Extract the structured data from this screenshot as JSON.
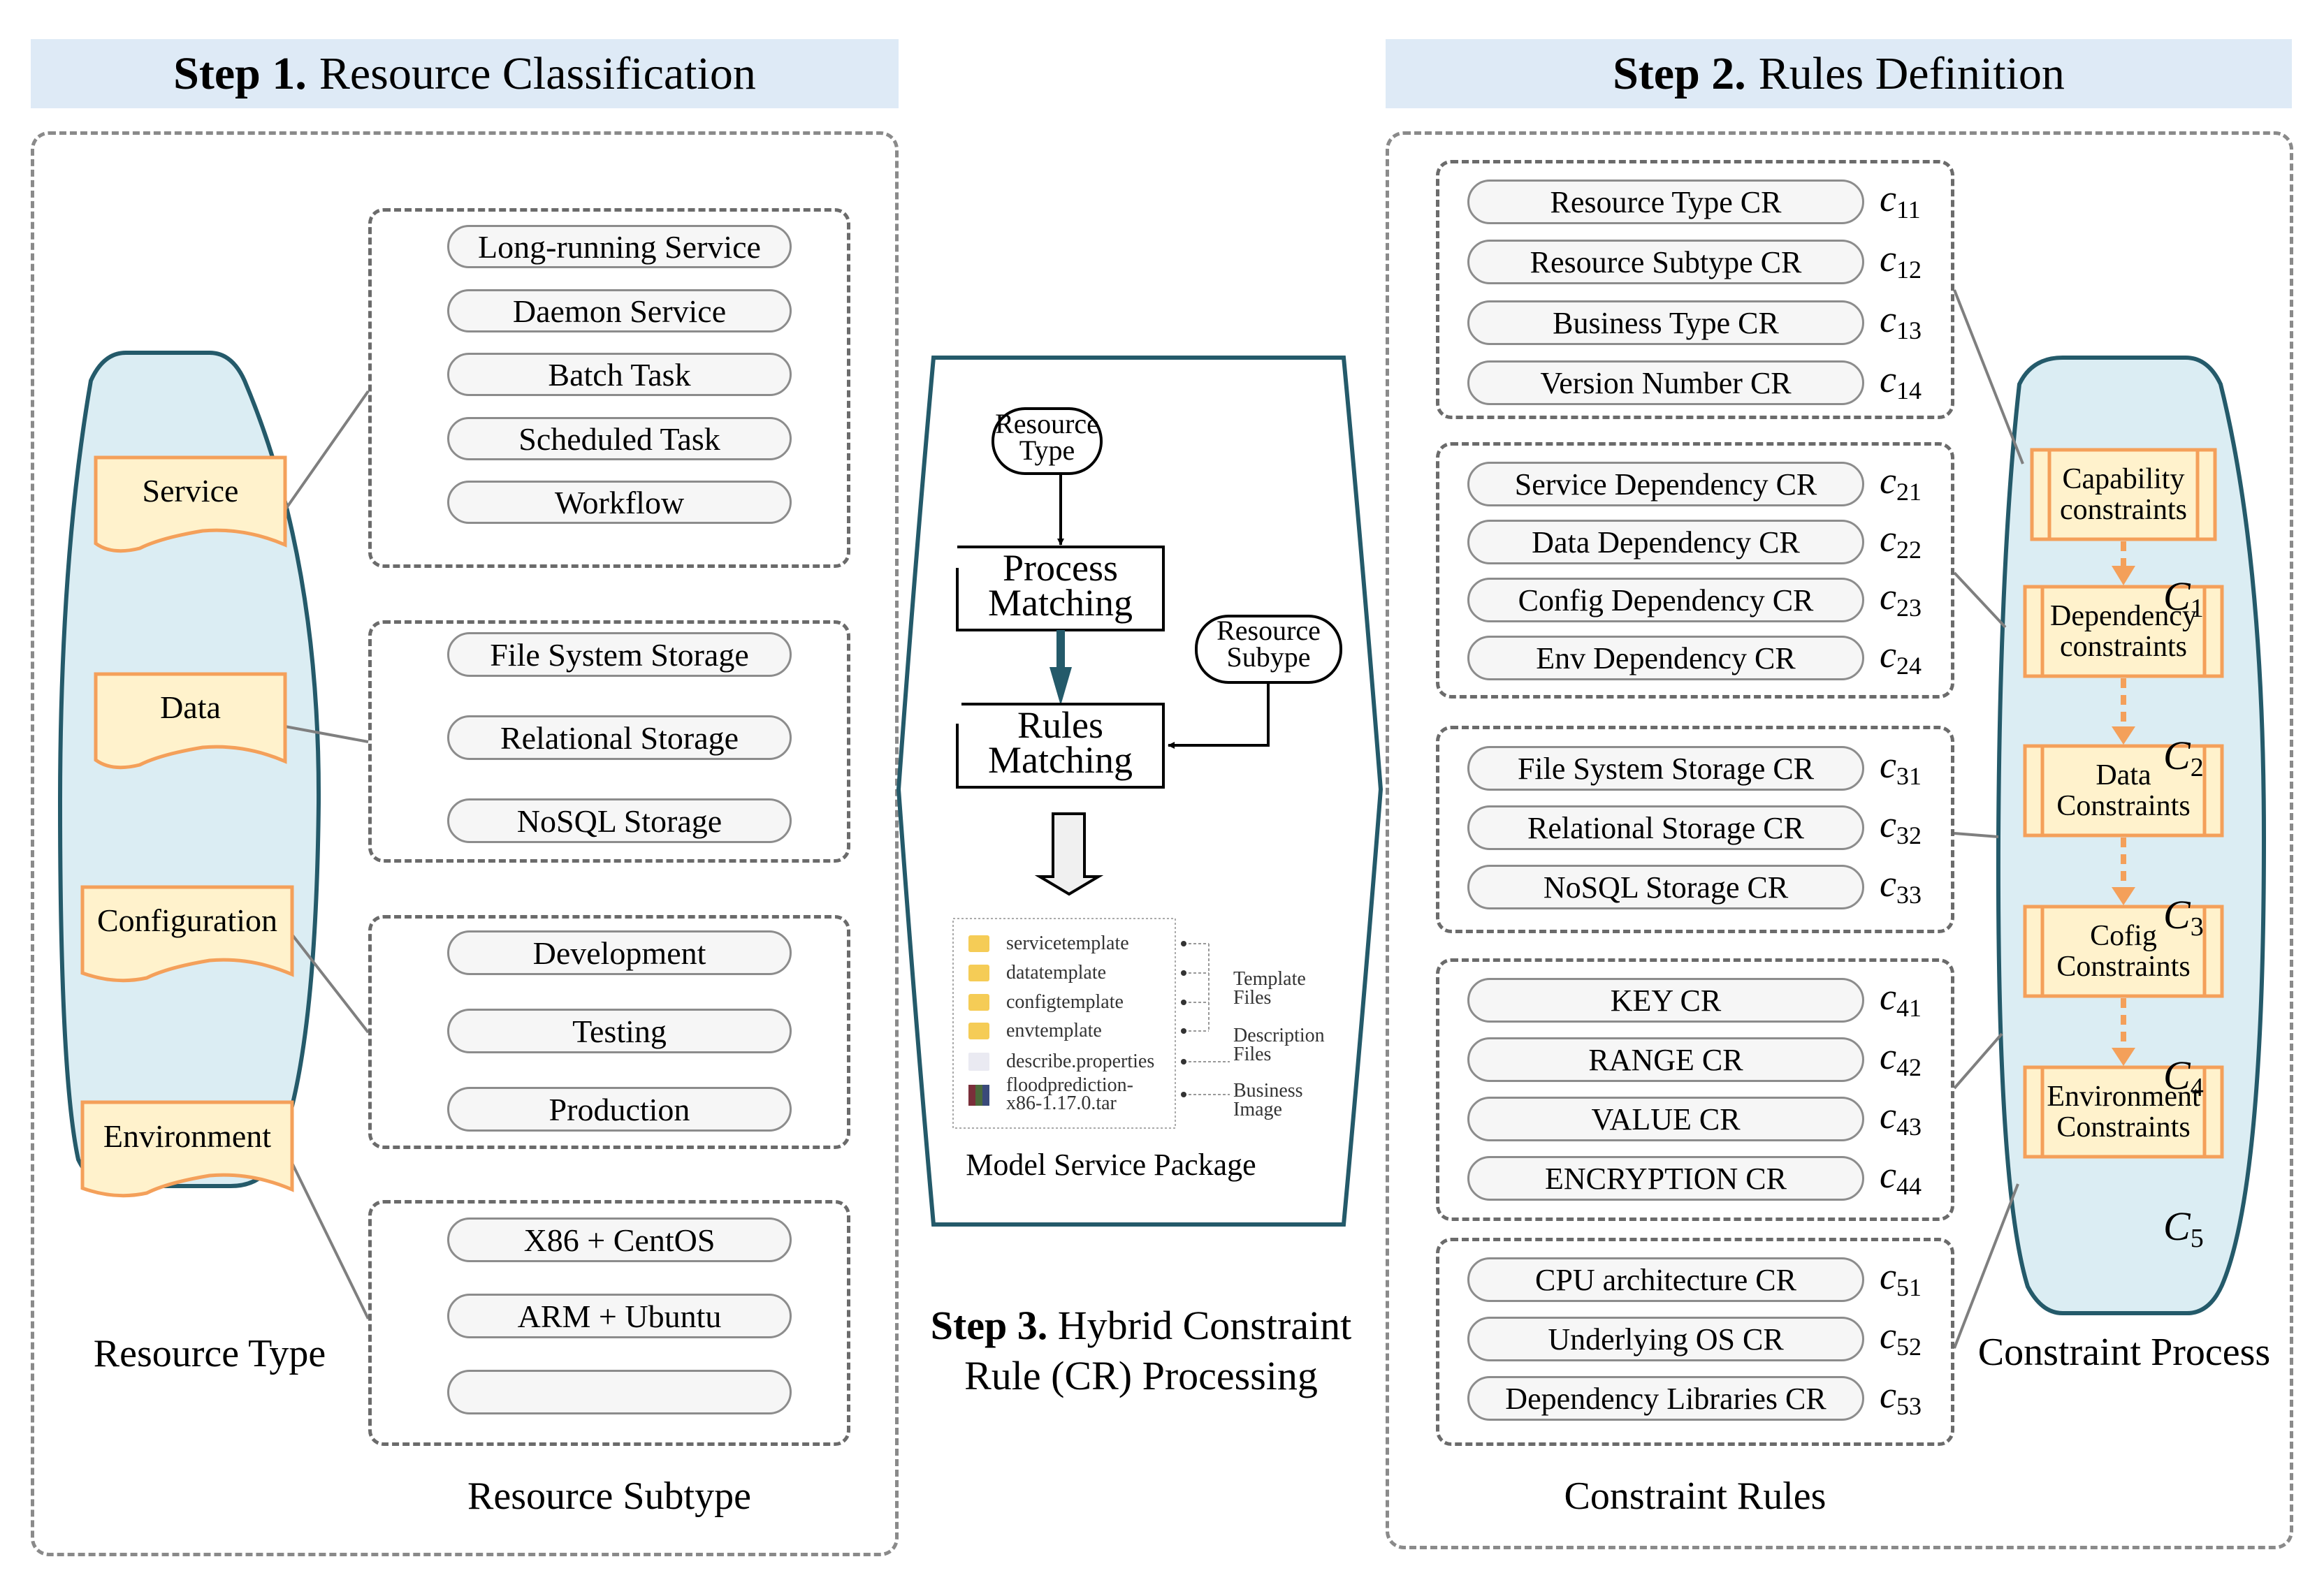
{
  "step1": {
    "header_bold": "Step 1.",
    "header_text": "Resource Classification",
    "resource_types": [
      "Service",
      "Data",
      "Configuration",
      "Environment"
    ],
    "resource_type_caption": "Resource Type",
    "subtype_groups": [
      [
        "Long-running Service",
        "Daemon Service",
        "Batch Task",
        "Scheduled Task",
        "Workflow"
      ],
      [
        "File System Storage",
        "Relational Storage",
        "NoSQL Storage"
      ],
      [
        "Development",
        "Testing",
        "Production"
      ],
      [
        "X86 + CentOS",
        "ARM + Ubuntu",
        ""
      ]
    ],
    "subtype_caption": "Resource Subtype"
  },
  "step2": {
    "header_bold": "Step 2.",
    "header_text": "Rules Definition",
    "rule_groups": [
      [
        {
          "label": "Resource Type CR",
          "c": "c",
          "sub": "11"
        },
        {
          "label": "Resource Subtype CR",
          "c": "c",
          "sub": "12"
        },
        {
          "label": "Business Type CR",
          "c": "c",
          "sub": "13"
        },
        {
          "label": "Version Number CR",
          "c": "c",
          "sub": "14"
        }
      ],
      [
        {
          "label": "Service Dependency CR",
          "c": "c",
          "sub": "21"
        },
        {
          "label": "Data Dependency CR",
          "c": "c",
          "sub": "22"
        },
        {
          "label": "Config Dependency CR",
          "c": "c",
          "sub": "23"
        },
        {
          "label": "Env Dependency CR",
          "c": "c",
          "sub": "24"
        }
      ],
      [
        {
          "label": "File System Storage CR",
          "c": "c",
          "sub": "31"
        },
        {
          "label": "Relational Storage CR",
          "c": "c",
          "sub": "32"
        },
        {
          "label": "NoSQL Storage CR",
          "c": "c",
          "sub": "33"
        }
      ],
      [
        {
          "label": "KEY CR",
          "c": "c",
          "sub": "41"
        },
        {
          "label": "RANGE CR",
          "c": "c",
          "sub": "42"
        },
        {
          "label": "VALUE CR",
          "c": "c",
          "sub": "43"
        },
        {
          "label": "ENCRYPTION CR",
          "c": "c",
          "sub": "44"
        }
      ],
      [
        {
          "label": "CPU architecture CR",
          "c": "c",
          "sub": "51"
        },
        {
          "label": "Underlying OS CR",
          "c": "c",
          "sub": "52"
        },
        {
          "label": "Dependency Libraries CR",
          "c": "c",
          "sub": "53"
        }
      ]
    ],
    "rules_caption": "Constraint Rules",
    "process_steps": [
      {
        "line1": "Capability",
        "line2": "constraints",
        "c": "C",
        "sub": "1"
      },
      {
        "line1": "Dependency",
        "line2": "constraints",
        "c": "C",
        "sub": "2"
      },
      {
        "line1": "Data",
        "line2": "Constraints",
        "c": "C",
        "sub": "3"
      },
      {
        "line1": "Cofig",
        "line2": "Constraints",
        "c": "C",
        "sub": "4"
      },
      {
        "line1": "Environment",
        "line2": "Constraints",
        "c": "C",
        "sub": "5"
      }
    ],
    "process_caption": "Constraint Process"
  },
  "step3": {
    "caption_bold": "Step 3.",
    "caption_line1": "Hybrid Constraint",
    "caption_line2": "Rule (CR) Processing",
    "flow": {
      "resource_type": [
        "Resource",
        "Type"
      ],
      "process_matching": [
        "Process",
        "Matching"
      ],
      "resource_subtype": [
        "Resource",
        "Subype"
      ],
      "rules_matching": [
        "Rules",
        "Matching"
      ]
    },
    "package": {
      "items": [
        "servicetemplate",
        "datatemplate",
        "configtemplate",
        "envtemplate",
        "describe.properties",
        "floodprediction-",
        "x86-1.17.0.tar"
      ],
      "notes": [
        [
          "Template",
          "Files"
        ],
        [
          "Description",
          "Files"
        ],
        [
          "Business",
          "Image"
        ]
      ],
      "caption": "Model Service Package"
    }
  },
  "colors": {
    "header_bg": "#deeaf6",
    "capsule_fill": "#dbedf3",
    "capsule_stroke": "#245a6a",
    "doc_fill": "#fff2cc",
    "doc_stroke": "#f4a05a",
    "teal_arrow": "#245a6a",
    "dash_gray": "#6b6b6b",
    "pill_fill": "#f6f6f6"
  }
}
